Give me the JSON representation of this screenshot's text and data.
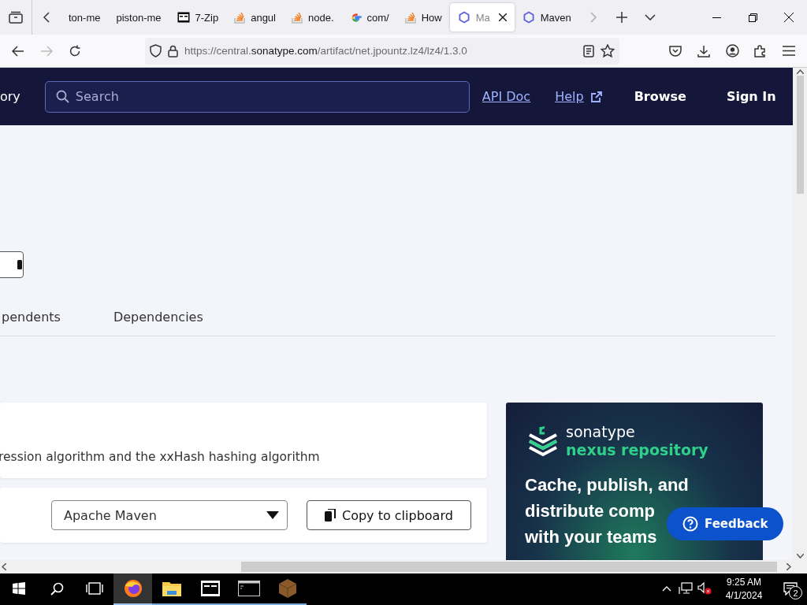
{
  "browser": {
    "tabs": [
      {
        "label": "ton-me",
        "kind": "plain",
        "selected": false
      },
      {
        "label": "piston-me",
        "kind": "plain",
        "selected": false
      },
      {
        "label": "7-Zip",
        "kind": "archive",
        "selected": false
      },
      {
        "label": "angul",
        "kind": "stack",
        "selected": false
      },
      {
        "label": "node.",
        "kind": "stack",
        "selected": false
      },
      {
        "label": "com/",
        "kind": "google",
        "selected": false
      },
      {
        "label": "How",
        "kind": "stack",
        "selected": false
      },
      {
        "label": "Ma",
        "kind": "hexagon",
        "selected": true
      },
      {
        "label": "Maven",
        "kind": "hexagon",
        "selected": false
      }
    ],
    "url": {
      "prefix": "https://central.",
      "host": "sonatype.com",
      "path": "/artifact/net.jpountz.lz4/lz4/1.3.0"
    }
  },
  "site": {
    "brand_fragment": "ory",
    "search": {
      "placeholder": "Search"
    },
    "links": [
      {
        "label": "API Doc",
        "kind": "link"
      },
      {
        "label": "Help",
        "kind": "external"
      },
      {
        "label": "Browse",
        "kind": "nav"
      },
      {
        "label": "Sign In",
        "kind": "nav"
      }
    ]
  },
  "page_tabs": [
    "pendents",
    "Dependencies"
  ],
  "description": "ression algorithm and the xxHash hashing algorithm",
  "snippet": {
    "build_tool": "Apache Maven",
    "copy_button": "Copy to clipboard"
  },
  "ad": {
    "brand": "sonatype",
    "product": "nexus repository",
    "headline": [
      "Cache, publish, and",
      "distribute comp",
      "with your teams"
    ]
  },
  "feedback": "Feedback",
  "taskbar": {
    "apps": [
      {
        "kind": "firefox",
        "active": true
      },
      {
        "kind": "folder",
        "active": false
      },
      {
        "kind": "archive",
        "active": false
      },
      {
        "kind": "terminal",
        "active": false
      },
      {
        "kind": "package",
        "active": false
      }
    ],
    "time": "9:25 AM",
    "date": "4/1/2024",
    "notifications": "2"
  }
}
